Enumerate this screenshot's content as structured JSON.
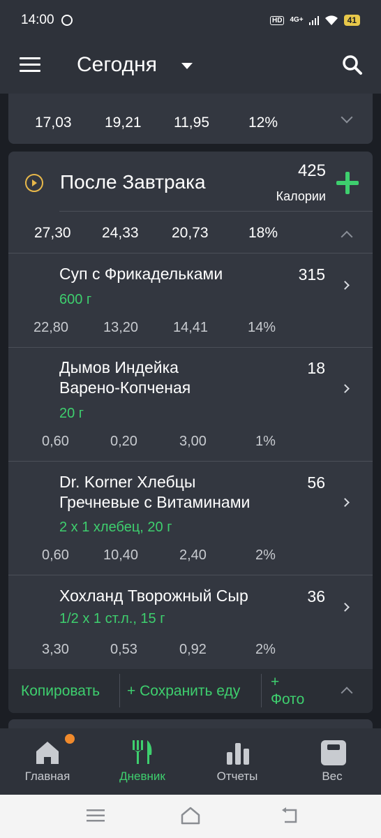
{
  "status_bar": {
    "time": "14:00",
    "hd": "HD",
    "network": "4G+",
    "battery": "41"
  },
  "app_bar": {
    "title": "Сегодня"
  },
  "summary": {
    "macros": [
      "17,03",
      "19,21",
      "11,95",
      "12%"
    ]
  },
  "meal": {
    "name": "После Завтрака",
    "calories": "425",
    "calories_label": "Калории",
    "macros": [
      "27,30",
      "24,33",
      "20,73",
      "18%"
    ],
    "items": [
      {
        "name_lines": [
          "Суп с Фрикадельками"
        ],
        "calories": "315",
        "portion": "600 г",
        "macros": [
          "22,80",
          "13,20",
          "14,41",
          "14%"
        ]
      },
      {
        "name_lines": [
          "Дымов Индейка",
          "Варено-Копченая"
        ],
        "calories": "18",
        "portion": "20 г",
        "macros": [
          "0,60",
          "0,20",
          "3,00",
          "1%"
        ]
      },
      {
        "name_lines": [
          "Dr. Korner Хлебцы",
          "Гречневые с Витаминами"
        ],
        "calories": "56",
        "portion": "2 x 1 хлебец, 20 г",
        "macros": [
          "0,60",
          "10,40",
          "2,40",
          "2%"
        ]
      },
      {
        "name_lines": [
          "Хохланд Творожный Сыр"
        ],
        "calories": "36",
        "portion": "1/2 x 1 ст.л., 15 г",
        "macros": [
          "3,30",
          "0,53",
          "0,92",
          "2%"
        ]
      }
    ],
    "actions": {
      "copy": "Копировать",
      "save": "+ Сохранить еду",
      "photo_plus": "+",
      "photo": "Фото"
    }
  },
  "bottom_nav": [
    {
      "label": "Главная",
      "icon": "home-icon"
    },
    {
      "label": "Дневник",
      "icon": "diary-icon"
    },
    {
      "label": "Отчеты",
      "icon": "reports-icon"
    },
    {
      "label": "Вес",
      "icon": "weight-icon"
    }
  ],
  "colors": {
    "accent": "#3ecf6e",
    "meal_icon": "#e8b84a",
    "badge": "#f08a2c",
    "background": "#1b1e24",
    "card": "#333740"
  }
}
